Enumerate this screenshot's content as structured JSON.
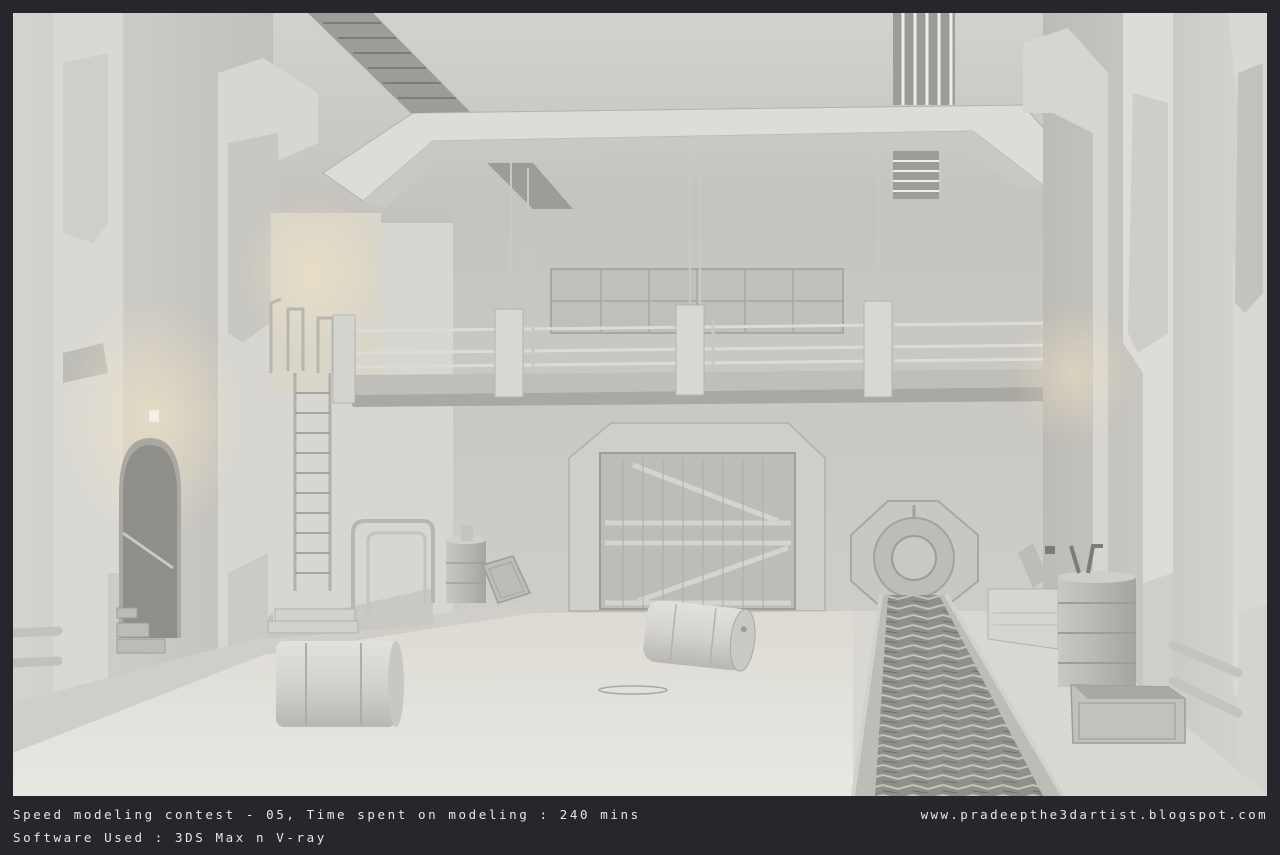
{
  "caption": {
    "line1": "Speed modeling contest - 05, Time spent on modeling : 240 mins",
    "line2": "Software Used : 3DS Max n V-ray",
    "website": "www.pradeepthe3dartist.blogspot.com"
  },
  "scene": {
    "description_tag": "industrial-hangar-render"
  },
  "colors": {
    "frame": "#25272c",
    "caption_text": "#e6e6e6",
    "warm_light": "#f3e6c4"
  }
}
